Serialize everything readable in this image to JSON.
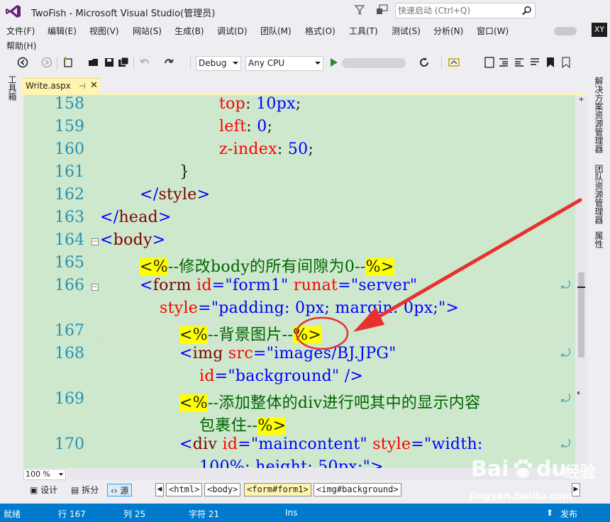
{
  "window": {
    "title": "TwoFish - Microsoft Visual Studio(管理员)",
    "quick_launch_placeholder": "快速启动 (Ctrl+Q)",
    "user_initials": "XY"
  },
  "menu": [
    "文件(F)",
    "编辑(E)",
    "视图(V)",
    "网站(S)",
    "生成(B)",
    "调试(D)",
    "团队(M)",
    "格式(O)",
    "工具(T)",
    "测试(S)",
    "分析(N)",
    "窗口(W)",
    "帮助(H)"
  ],
  "toolbar": {
    "config": "Debug",
    "platform": "Any CPU"
  },
  "side_tabs": {
    "left": "工具箱",
    "right": [
      "解决方案资源管理器",
      "团队资源管理器",
      "属性"
    ]
  },
  "document_tab": {
    "label": "Write.aspx",
    "pin_glyph": "⊣",
    "close_glyph": "✕"
  },
  "code_lines": [
    {
      "num": "158",
      "text": "top: 10px;"
    },
    {
      "num": "159",
      "text": "left: 0;"
    },
    {
      "num": "160",
      "text": "z-index: 50;"
    },
    {
      "num": "161",
      "text": "}"
    },
    {
      "num": "162",
      "text": "</style>"
    },
    {
      "num": "163",
      "text": "</head>"
    },
    {
      "num": "164",
      "text": "<body>"
    },
    {
      "num": "165",
      "text": "<%--修改body的所有间隙为0--%>"
    },
    {
      "num": "166",
      "text": "<form id=\"form1\" runat=\"server\""
    },
    {
      "num": "",
      "text": "style=\"padding: 0px; margin: 0px;\">"
    },
    {
      "num": "167",
      "text": "<%--背景图片--%>"
    },
    {
      "num": "168",
      "text": "<img src=\"images/BJ.JPG\""
    },
    {
      "num": "",
      "text": "id=\"background\" />"
    },
    {
      "num": "169",
      "text": "<%--添加整体的div进行吧其中的显示内容"
    },
    {
      "num": "",
      "text": "包裹住--%>"
    },
    {
      "num": "170",
      "text": "<div id=\"maincontent\" style=\"width:"
    },
    {
      "num": "",
      "text": "100%; height: 50px;\">"
    }
  ],
  "zoom": "100 %",
  "view_tabs": [
    "设计",
    "拆分",
    "源"
  ],
  "breadcrumbs": [
    "<html>",
    "<body>",
    "<form#form1>",
    "<img#background>"
  ],
  "status": {
    "ready": "就绪",
    "line": "行 167",
    "col": "列 25",
    "char": "字符 21",
    "mode": "Ins",
    "publish": "发布"
  },
  "watermark": {
    "brand": "Bai",
    "brand2": "du",
    "cn": "经验",
    "url": "jingyan.baidu.com"
  },
  "colors": {
    "editor_bg": "#cde8cd",
    "statusbar": "#007acc",
    "annotation": "#e8312f",
    "tab_active": "#fff5b0"
  }
}
